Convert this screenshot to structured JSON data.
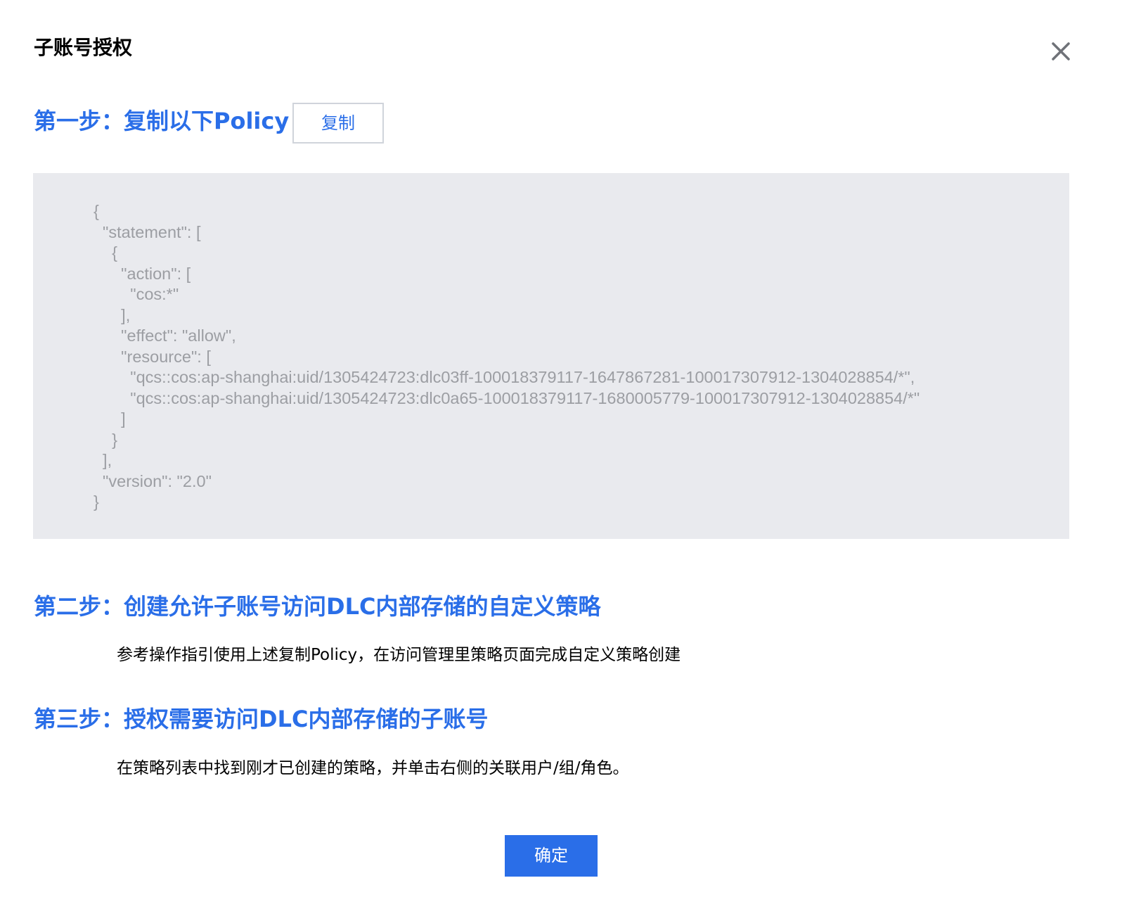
{
  "dialog": {
    "title": "子账号授权",
    "close_icon": "close-icon"
  },
  "step1": {
    "title": "第一步：复制以下Policy",
    "copy_label": "复制",
    "policy_code": "{\n  \"statement\": [\n    {\n      \"action\": [\n        \"cos:*\"\n      ],\n      \"effect\": \"allow\",\n      \"resource\": [\n        \"qcs::cos:ap-shanghai:uid/1305424723:dlc03ff-100018379117-1647867281-100017307912-1304028854/*\",\n        \"qcs::cos:ap-shanghai:uid/1305424723:dlc0a65-100018379117-1680005779-100017307912-1304028854/*\"\n      ]\n    }\n  ],\n  \"version\": \"2.0\"\n}"
  },
  "step2": {
    "title": "第二步：创建允许子账号访问DLC内部存储的自定义策略",
    "description": "参考操作指引使用上述复制Policy，在访问管理里策略页面完成自定义策略创建"
  },
  "step3": {
    "title": "第三步：授权需要访问DLC内部存储的子账号",
    "description": "在策略列表中找到刚才已创建的策略，并单击右侧的关联用户/组/角色。"
  },
  "footer": {
    "confirm_label": "确定"
  },
  "colors": {
    "accent": "#2a6ee8",
    "code_background": "#e9eaee",
    "code_text": "#9c9ea3",
    "button_border": "#d0d4db"
  }
}
